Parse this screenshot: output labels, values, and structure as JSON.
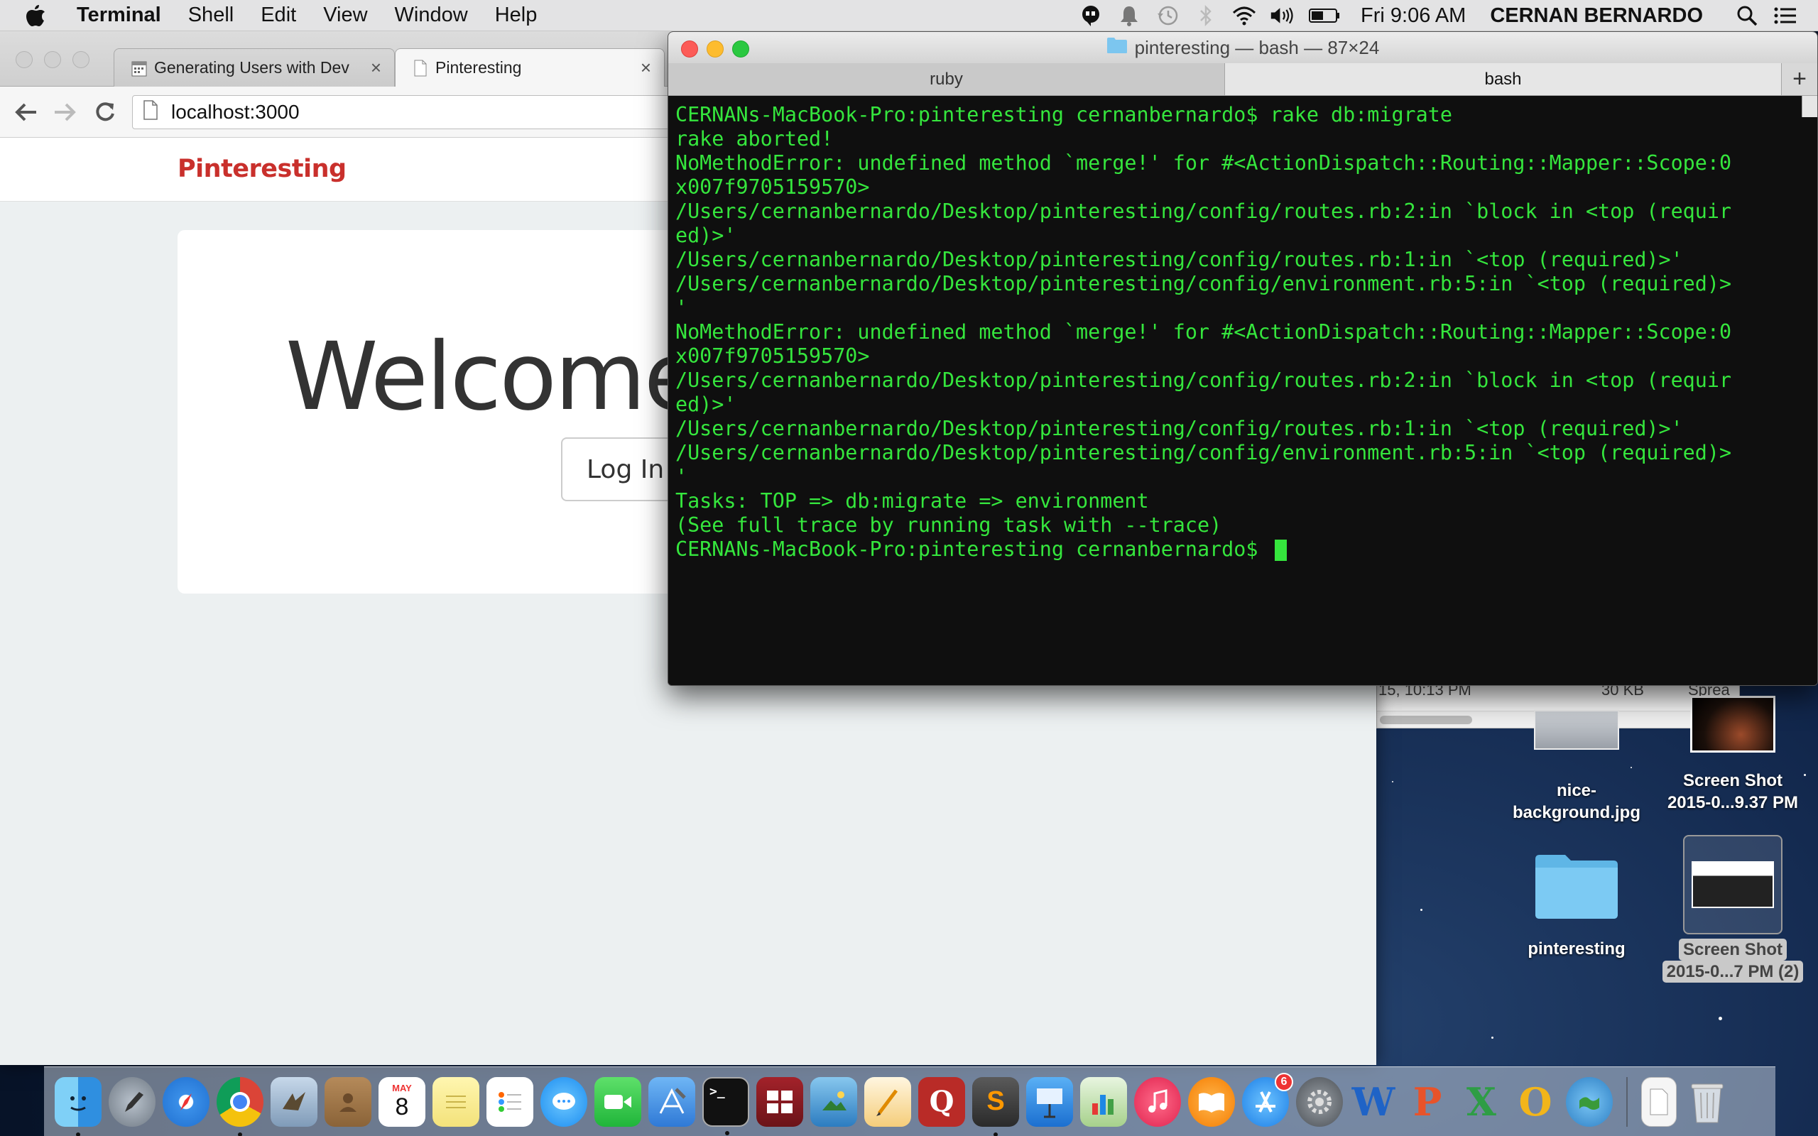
{
  "menubar": {
    "app_name": "Terminal",
    "items": [
      "Shell",
      "Edit",
      "View",
      "Window",
      "Help"
    ],
    "clock": "Fri 9:06 AM",
    "user": "CERNAN BERNARDO",
    "status_icons": [
      "hangouts-icon",
      "notification-bell-icon",
      "time-machine-icon",
      "bluetooth-icon",
      "wifi-icon",
      "volume-icon",
      "battery-icon"
    ]
  },
  "browser": {
    "tabs": [
      {
        "title": "Generating Users with Dev",
        "active": false
      },
      {
        "title": "Pinteresting",
        "active": true
      }
    ],
    "url": "localhost:3000",
    "page": {
      "brand": "Pinteresting",
      "headline": "Welcome to my app!",
      "login_button": "Log In"
    }
  },
  "terminal": {
    "title": "pinteresting — bash — 87×24",
    "tabs": [
      {
        "label": "ruby",
        "active": false
      },
      {
        "label": "bash",
        "active": true
      }
    ],
    "new_tab_label": "+",
    "text_color": "#35e63d",
    "lines": [
      "CERNANs-MacBook-Pro:pinteresting cernanbernardo$ rake db:migrate",
      "rake aborted!",
      "NoMethodError: undefined method `merge!' for #<ActionDispatch::Routing::Mapper::Scope:0",
      "x007f9705159570>",
      "/Users/cernanbernardo/Desktop/pinteresting/config/routes.rb:2:in `block in <top (requir",
      "ed)>'",
      "/Users/cernanbernardo/Desktop/pinteresting/config/routes.rb:1:in `<top (required)>'",
      "/Users/cernanbernardo/Desktop/pinteresting/config/environment.rb:5:in `<top (required)>",
      "'",
      "NoMethodError: undefined method `merge!' for #<ActionDispatch::Routing::Mapper::Scope:0",
      "x007f9705159570>",
      "/Users/cernanbernardo/Desktop/pinteresting/config/routes.rb:2:in `block in <top (requir",
      "ed)>'",
      "/Users/cernanbernardo/Desktop/pinteresting/config/routes.rb:1:in `<top (required)>'",
      "/Users/cernanbernardo/Desktop/pinteresting/config/environment.rb:5:in `<top (required)>",
      "'",
      "Tasks: TOP => db:migrate => environment",
      "(See full trace by running task with --trace)"
    ],
    "prompt": "CERNANs-MacBook-Pro:pinteresting cernanbernardo$ "
  },
  "finder": {
    "last_row": {
      "date": "15, 10:13 PM",
      "size": "30 KB",
      "kind": "Sprea"
    }
  },
  "desktop_icons": [
    {
      "label_1": "nice-",
      "label_2": "background.jpg"
    },
    {
      "label_1": "Screen Shot",
      "label_2": "2015-0...9.37 PM"
    },
    {
      "label_1": "pinteresting"
    },
    {
      "label_1": "Screen Shot",
      "label_2": "2015-0...7 PM (2)"
    }
  ],
  "dock": {
    "calendar_month": "MAY",
    "calendar_day": "8",
    "app_store_badge": "6",
    "apps": [
      "finder",
      "launchpad",
      "safari",
      "chrome",
      "mail",
      "contacts",
      "calendar",
      "notes",
      "reminders",
      "messages",
      "facetime",
      "xcode",
      "terminal",
      "photo-booth",
      "iphoto",
      "pages",
      "quora",
      "sublime-text",
      "keynote",
      "numbers",
      "itunes",
      "ibooks",
      "app-store",
      "system-preferences",
      "word",
      "powerpoint",
      "excel",
      "outlook",
      "network",
      "documents",
      "trash"
    ]
  }
}
